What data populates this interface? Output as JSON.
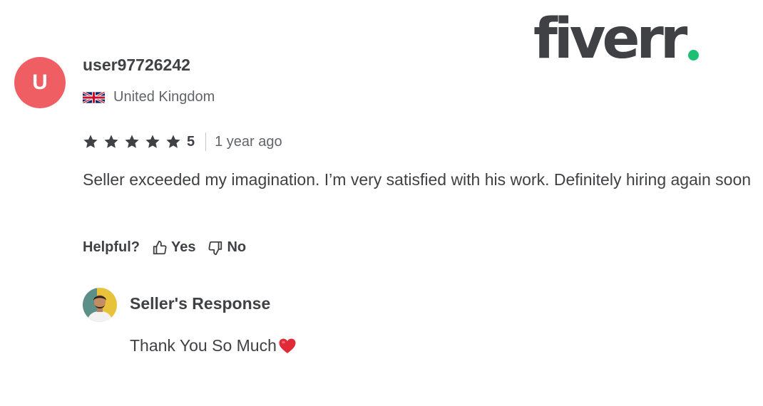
{
  "brand": {
    "logo_text": "fiverr",
    "accent_color": "#1dbf73"
  },
  "review": {
    "avatar_initial": "U",
    "avatar_color": "#ee5e63",
    "username": "user97726242",
    "country": {
      "flag_icon": "uk-flag-icon",
      "name": "United Kingdom"
    },
    "rating": {
      "stars": 5,
      "max_stars": 5,
      "value": "5"
    },
    "time_ago": "1 year ago",
    "text": "Seller exceeded my imagination. I’m very satisfied with his work. Definitely hiring again soon",
    "helpful": {
      "label": "Helpful?",
      "yes_label": "Yes",
      "no_label": "No"
    }
  },
  "seller_response": {
    "title": "Seller's Response",
    "text": "Thank You So Much",
    "emoji_icon": "red-heart-icon"
  }
}
